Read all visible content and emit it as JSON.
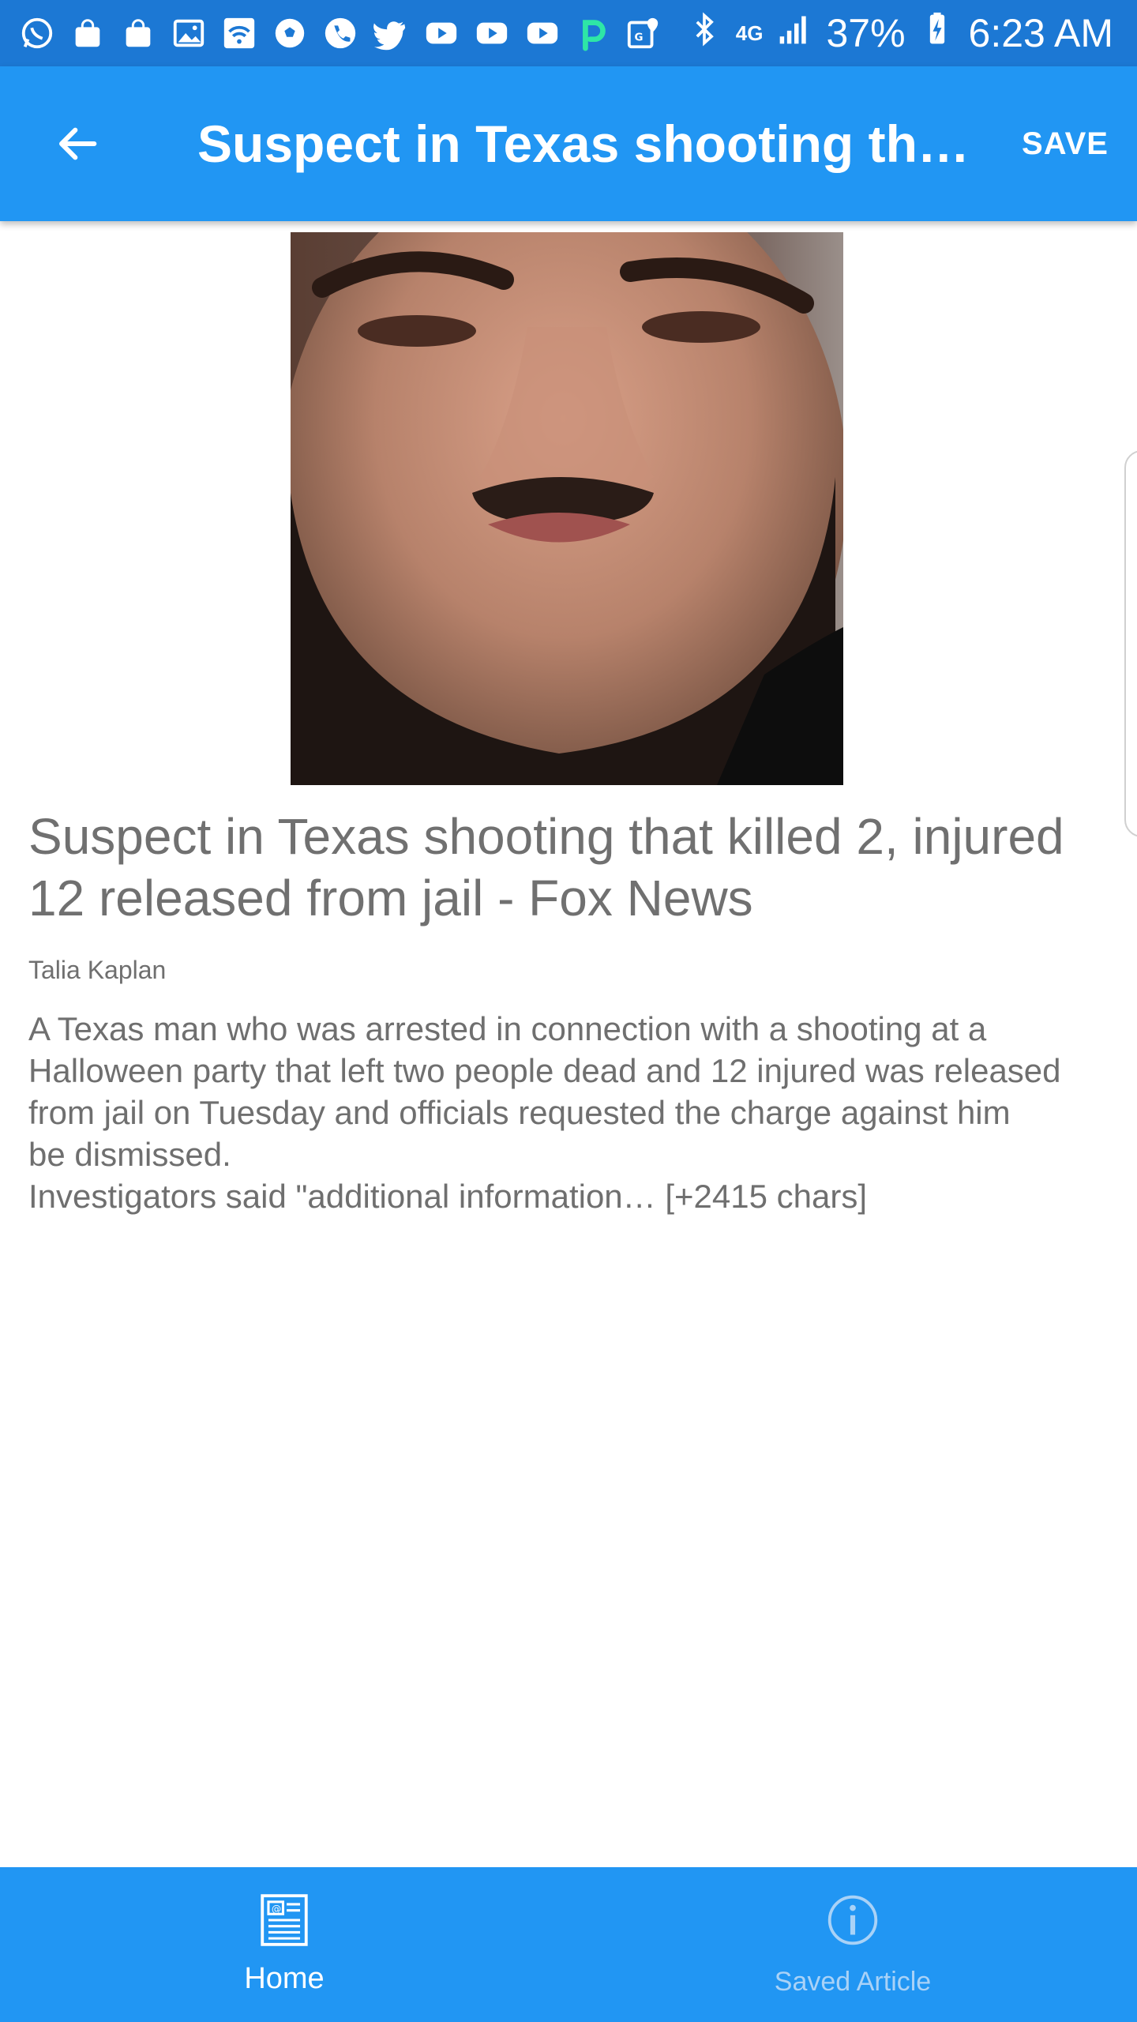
{
  "status_bar": {
    "left_icons": [
      "whatsapp-icon",
      "shopping-bag-icon",
      "shopping-bag-icon",
      "gallery-icon",
      "wifi-icon",
      "soccer-icon",
      "phone-icon",
      "twitter-icon",
      "youtube-icon",
      "youtube-icon",
      "youtube-icon",
      "p-app-icon",
      "maps-icon"
    ],
    "network": "4G",
    "battery": "37%",
    "time": "6:23 AM"
  },
  "app_bar": {
    "title": "Suspect in Texas shooting tha…",
    "save_label": "SAVE"
  },
  "article": {
    "headline": "Suspect in Texas shooting that killed 2, injured 12 released from jail - Fox News",
    "author": "Talia Kaplan",
    "description_lines": [
      "A Texas man who was arrested in connection with a shooting at a",
      "Halloween party that left two people dead and 12 injured was released",
      "from jail on Tuesday and officials requested the charge against him",
      "be dismissed.",
      "Investigators said \"additional information… [+2415 chars]"
    ]
  },
  "bottom_nav": {
    "home_label": "Home",
    "saved_label": "Saved Article"
  },
  "colors": {
    "status_bar": "#1c78d4",
    "app_bar": "#2196f3",
    "text_gray": "#707070",
    "nav_inactive": "#a9d2f7"
  }
}
